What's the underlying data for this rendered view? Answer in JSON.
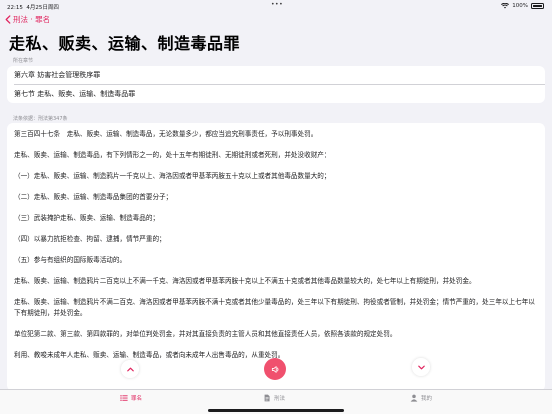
{
  "status": {
    "time": "22:15",
    "date": "4月25日周四",
    "battery": "100%"
  },
  "nav": {
    "back_label": "刑法 · 罪名"
  },
  "title": "走私、贩卖、运输、制造毒品罪",
  "chapter_section": {
    "label": "所在章节",
    "chapter": "第六章 妨害社会管理秩序罪",
    "section": "第七节 走私、贩卖、运输、制造毒品罪"
  },
  "law": {
    "label": "法条依据：刑法第347条",
    "paragraphs": [
      "第三百四十七条　走私、贩卖、运输、制造毒品，无论数量多少，都应当追究刑事责任，予以刑事处罚。",
      "走私、贩卖、运输、制造毒品，有下列情形之一的，处十五年有期徒刑、无期徒刑或者死刑，并处没收财产：",
      "（一）走私、贩卖、运输、制造鸦片一千克以上、海洛因或者甲基苯丙胺五十克以上或者其他毒品数量大的；",
      "（二）走私、贩卖、运输、制造毒品集团的首要分子；",
      "（三）武装掩护走私、贩卖、运输、制造毒品的；",
      "（四）以暴力抗拒检查、拘留、逮捕，情节严重的；",
      "（五）参与有组织的国际贩毒活动的。",
      "走私、贩卖、运输、制造鸦片二百克以上不满一千克、海洛因或者甲基苯丙胺十克以上不满五十克或者其他毒品数量较大的，处七年以上有期徒刑，并处罚金。",
      "走私、贩卖、运输、制造鸦片不满二百克、海洛因或者甲基苯丙胺不满十克或者其他少量毒品的，处三年以下有期徒刑、拘役或者管制，并处罚金；情节严重的，处三年以上七年以下有期徒刑，并处罚金。",
      "单位犯第二款、第三款、第四款罪的，对单位判处罚金，并对其直接负责的主管人员和其他直接责任人员，依照各该款的规定处罚。",
      "利用、教唆未成年人走私、贩卖、运输、制造毒品，或者向未成年人出售毒品的，从重处罚。"
    ]
  },
  "tabs": [
    {
      "label": "罪名"
    },
    {
      "label": "刑法"
    },
    {
      "label": "我的"
    }
  ],
  "colors": {
    "accent": "#e0245e",
    "speak": "#f0506e"
  }
}
